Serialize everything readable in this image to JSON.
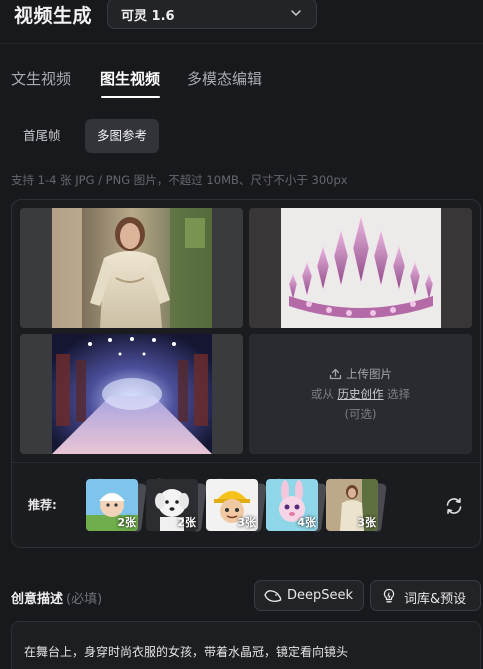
{
  "header": {
    "title": "视频生成",
    "model_select": {
      "value": "可灵 1.6"
    }
  },
  "tabs": [
    {
      "label": "文生视频",
      "active": false
    },
    {
      "label": "图生视频",
      "active": true
    },
    {
      "label": "多模态编辑",
      "active": false
    }
  ],
  "subtabs": [
    {
      "label": "首尾帧",
      "active": false
    },
    {
      "label": "多图参考",
      "active": true
    }
  ],
  "hint": "支持 1-4 张 JPG / PNG 图片，不超过 10MB、尺寸不小于 300px",
  "upload": {
    "title": "上传图片",
    "or_prefix": "或从",
    "history_link": "历史创作",
    "or_suffix": "选择",
    "optional": "(可选)"
  },
  "recommend": {
    "label": "推荐:",
    "items": [
      {
        "count": "2张"
      },
      {
        "count": "2张"
      },
      {
        "count": "3张"
      },
      {
        "count": "4张"
      },
      {
        "count": "3张"
      }
    ]
  },
  "prompt": {
    "label": "创意描述",
    "required": "(必填)",
    "deepseek_label": "DeepSeek",
    "presets_label": "词库&预设",
    "text": "在舞台上，身穿时尚衣服的女孩，带着水晶冠，镜定看向镜头"
  },
  "icons": [
    "chevron-down-icon",
    "upload-icon",
    "refresh-icon",
    "deepseek-whale-icon",
    "lightbulb-icon"
  ]
}
